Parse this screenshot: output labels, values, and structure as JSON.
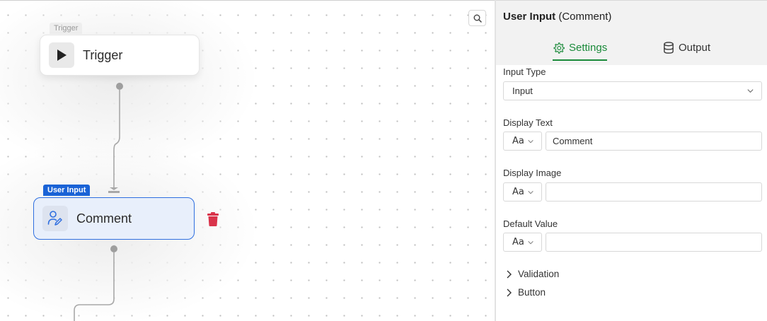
{
  "canvas": {
    "trigger_node": {
      "tag": "Trigger",
      "label": "Trigger"
    },
    "comment_node": {
      "tag": "User Input",
      "label": "Comment"
    }
  },
  "panel": {
    "title_main": "User Input",
    "title_sub": "(Comment)",
    "tabs": [
      {
        "label": "Settings",
        "icon": "gear-icon",
        "active": true
      },
      {
        "label": "Output",
        "icon": "database-icon",
        "active": false
      }
    ],
    "fields": {
      "input_type": {
        "label": "Input Type",
        "value": "Input"
      },
      "display_text": {
        "label": "Display Text",
        "type_label": "Aa",
        "value": "Comment"
      },
      "display_image": {
        "label": "Display Image",
        "type_label": "Aa",
        "value": ""
      },
      "default_value": {
        "label": "Default Value",
        "type_label": "Aa",
        "value": ""
      }
    },
    "sections": [
      {
        "label": "Validation"
      },
      {
        "label": "Button"
      }
    ]
  },
  "colors": {
    "accent_green": "#1a8a3a",
    "node_blue": "#1a63d6",
    "delete_red": "#d9344b"
  }
}
